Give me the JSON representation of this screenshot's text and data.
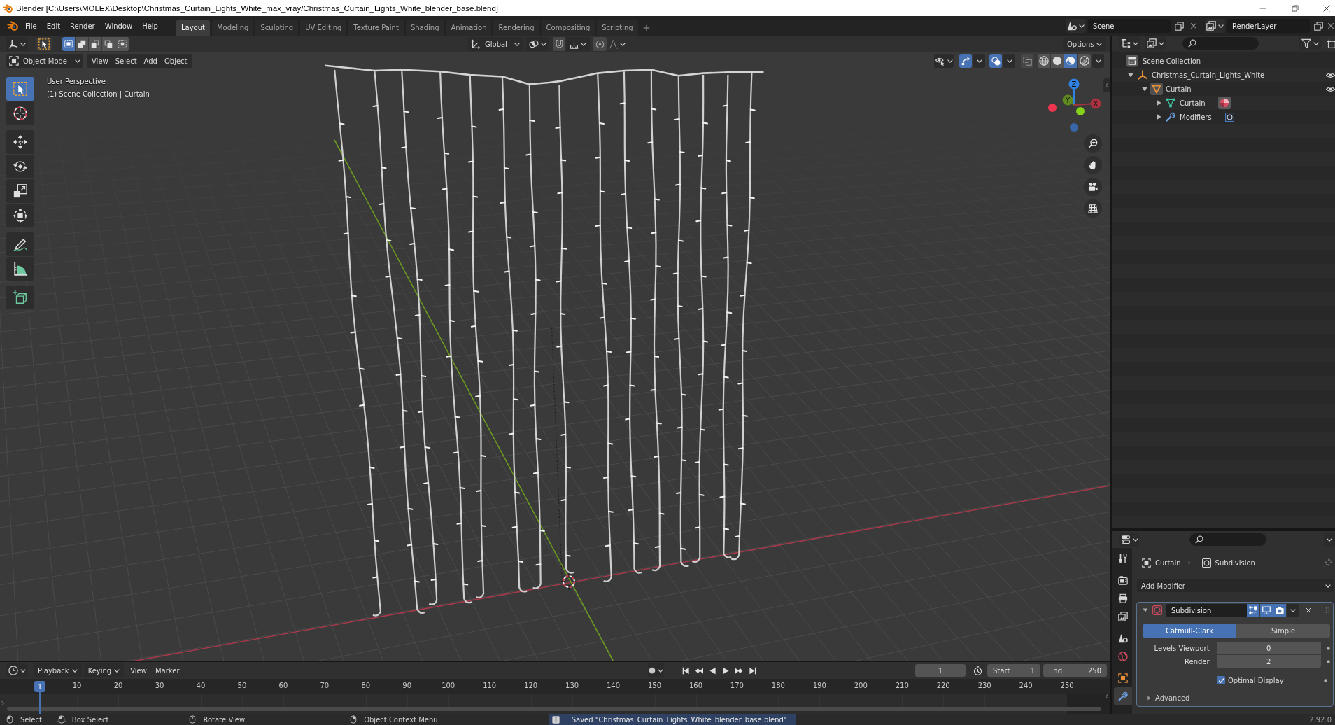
{
  "window": {
    "title": "Blender [C:\\Users\\MOLEX\\Desktop\\Christmas_Curtain_Lights_White_max_vray/Christmas_Curtain_Lights_White_blender_base.blend]"
  },
  "menu": [
    "File",
    "Edit",
    "Render",
    "Window",
    "Help"
  ],
  "workspaces": [
    {
      "label": "Layout",
      "selected": true
    },
    {
      "label": "Modeling",
      "selected": false
    },
    {
      "label": "Sculpting",
      "selected": false
    },
    {
      "label": "UV Editing",
      "selected": false
    },
    {
      "label": "Texture Paint",
      "selected": false
    },
    {
      "label": "Shading",
      "selected": false
    },
    {
      "label": "Animation",
      "selected": false
    },
    {
      "label": "Rendering",
      "selected": false
    },
    {
      "label": "Compositing",
      "selected": false
    },
    {
      "label": "Scripting",
      "selected": false
    }
  ],
  "scene": {
    "value": "Scene"
  },
  "view_layer": {
    "value": "RenderLayer"
  },
  "viewport": {
    "select_modes": [
      {
        "kind": "set",
        "selected": true
      },
      {
        "kind": "extend",
        "selected": false
      },
      {
        "kind": "subtract",
        "selected": false
      },
      {
        "kind": "invert",
        "selected": false
      },
      {
        "kind": "intersect",
        "selected": false
      }
    ],
    "orientation": "Global",
    "snap": {
      "on": false
    },
    "proportional": {
      "on": false
    },
    "options": "Options",
    "mode": "Object Mode",
    "menus": [
      "View",
      "Select",
      "Add",
      "Object"
    ],
    "gizmos": {
      "on": true
    },
    "overlays": {
      "on": true
    },
    "xray": {
      "on": false
    },
    "shading": [
      {
        "kind": "wireframe",
        "selected": false
      },
      {
        "kind": "solid",
        "selected": false
      },
      {
        "kind": "material",
        "selected": true
      },
      {
        "kind": "rendered",
        "selected": false
      }
    ],
    "view_info": [
      "User Perspective",
      "(1) Scene Collection | Curtain"
    ],
    "tools": [
      {
        "kind": "select",
        "selected": true
      },
      {
        "kind": "cursor",
        "selected": false
      },
      {
        "kind": "move",
        "selected": false
      },
      {
        "kind": "rotate",
        "selected": false
      },
      {
        "kind": "scale",
        "selected": false
      },
      {
        "kind": "transform",
        "selected": false
      },
      {
        "kind": "annotate",
        "selected": false
      },
      {
        "kind": "measure",
        "selected": false
      },
      {
        "kind": "add_cube",
        "selected": false
      }
    ],
    "axes": [
      {
        "kind": "z",
        "label": "Z"
      },
      {
        "kind": "y",
        "label": "Y"
      },
      {
        "kind": "x",
        "label": "X"
      }
    ]
  },
  "outliner": {
    "root": "Scene Collection",
    "items": [
      {
        "label": "Christmas_Curtain_Lights_White",
        "kind": "empty",
        "expanded": true,
        "visible": true,
        "active": false,
        "children": [
          {
            "label": "Curtain",
            "kind": "object",
            "expanded": true,
            "visible": true,
            "active": true,
            "children": [
              {
                "label": "Curtain",
                "kind": "mesh",
                "expanded": false,
                "active": false
              },
              {
                "label": "Modifiers",
                "kind": "modifiers",
                "expanded": false,
                "active": false
              }
            ]
          }
        ]
      }
    ]
  },
  "properties": {
    "tabs": [
      {
        "kind": "tool",
        "selected": false
      },
      {
        "kind": "render",
        "selected": false
      },
      {
        "kind": "output",
        "selected": false
      },
      {
        "kind": "view_layer",
        "selected": false
      },
      {
        "kind": "scene",
        "selected": false
      },
      {
        "kind": "world",
        "selected": false
      },
      {
        "kind": "object",
        "selected": false
      },
      {
        "kind": "modifiers",
        "selected": true
      }
    ],
    "breadcrumb": [
      "Curtain",
      "Subdivision"
    ],
    "add_modifier": "Add Modifier",
    "modifier": {
      "name": "Subdivision",
      "expanded": true,
      "edit_mode": true,
      "show_viewport": true,
      "show_render": true,
      "algorithms": [
        {
          "label": "Catmull-Clark",
          "selected": true
        },
        {
          "label": "Simple",
          "selected": false
        }
      ],
      "fields": [
        {
          "label": "Levels Viewport",
          "value": "0"
        },
        {
          "label": "Render",
          "value": "2"
        }
      ],
      "optimal_display": {
        "label": "Optimal Display",
        "checked": true
      },
      "advanced": {
        "label": "Advanced",
        "expanded": false
      }
    }
  },
  "timeline": {
    "menus": [
      "Playback",
      "Keying",
      "View",
      "Marker"
    ],
    "current_frame": "1",
    "start": {
      "label": "Start",
      "value": "1"
    },
    "end": {
      "label": "End",
      "value": "250"
    },
    "playhead": "1",
    "ruler": [
      "10",
      "20",
      "30",
      "40",
      "50",
      "60",
      "70",
      "80",
      "90",
      "100",
      "110",
      "120",
      "130",
      "140",
      "150",
      "160",
      "170",
      "180",
      "190",
      "200",
      "210",
      "220",
      "230",
      "240",
      "250"
    ]
  },
  "status_bar": {
    "hints": [
      {
        "kind": "left",
        "label": "Select"
      },
      {
        "kind": "drag",
        "label": "Box Select"
      },
      {
        "kind": "middle",
        "label": "Rotate View"
      },
      {
        "kind": "right",
        "label": "Object Context Menu"
      }
    ],
    "message": "Saved \"Christmas_Curtain_Lights_White_blender_base.blend\"",
    "version": "2.92.0"
  }
}
